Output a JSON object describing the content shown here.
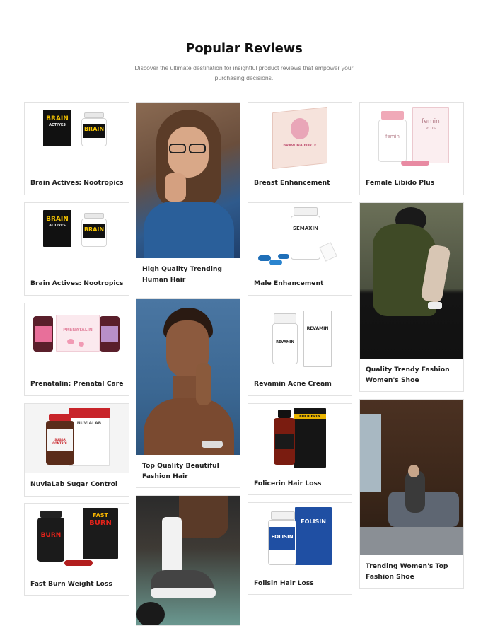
{
  "section": {
    "title": "Popular Reviews",
    "subtitle": "Discover the ultimate destination for insightful product reviews that empower your purchasing decisions."
  },
  "cards": [
    {
      "title": "Brain Actives: Nootropics",
      "image": "brain-actives-product-image"
    },
    {
      "title": "High Quality Trending Human Hair",
      "image": "woman-glasses-photo"
    },
    {
      "title": "Breast Enhancement",
      "image": "bravona-forte-product-image"
    },
    {
      "title": "Female Libido Plus",
      "image": "femin-plus-product-image"
    },
    {
      "title": "Brain Actives: Nootropics",
      "image": "brain-actives-product-image"
    },
    {
      "title": "Male Enhancement",
      "image": "semaxin-product-image"
    },
    {
      "title": "Quality Trendy Fashion Women's Shoe",
      "image": "fashion-woman-coat-photo"
    },
    {
      "title": "Prenatalin: Prenatal Care",
      "image": "prenatalin-product-image"
    },
    {
      "title": "Top Quality Beautiful Fashion Hair",
      "image": "woman-portrait-photo"
    },
    {
      "title": "Revamin Acne Cream",
      "image": "revamin-product-image"
    },
    {
      "title": "NuviaLab Sugar Control",
      "image": "nuvialab-product-image"
    },
    {
      "title": "Folicerin Hair Loss",
      "image": "folicerin-product-image"
    },
    {
      "title": "Trending Women's Top Fashion Shoe",
      "image": "woman-bedroom-photo"
    },
    {
      "title": "Fast Burn Weight Loss",
      "image": "fast-burn-product-image"
    },
    {
      "title": "Folisin Hair Loss",
      "image": "folisin-product-image"
    },
    {
      "title": "",
      "image": "sneakers-photo"
    }
  ],
  "product_labels": {
    "brain_top": "BRAIN",
    "brain_sub": "ACTIVES",
    "bravona": "BRAVONA FORTE",
    "femin": "femin",
    "femin_sub": "PLUS",
    "semaxin": "SEMAXIN",
    "prenatalin": "PRENATALIN",
    "revamin": "REVAMIN",
    "nuvialab": "NUVIALAB",
    "nuvialab_sub": "SUGAR CONTROL",
    "folicerin": "FOLICERIN",
    "fastburn_top": "FAST",
    "fastburn_bottom": "BURN",
    "folisin": "FOLISIN"
  },
  "colors": {
    "accent_pink": "#e9a6b8",
    "accent_red": "#c8242a",
    "brand_blue": "#1f4fa3",
    "card_border": "#e2e2e2"
  }
}
